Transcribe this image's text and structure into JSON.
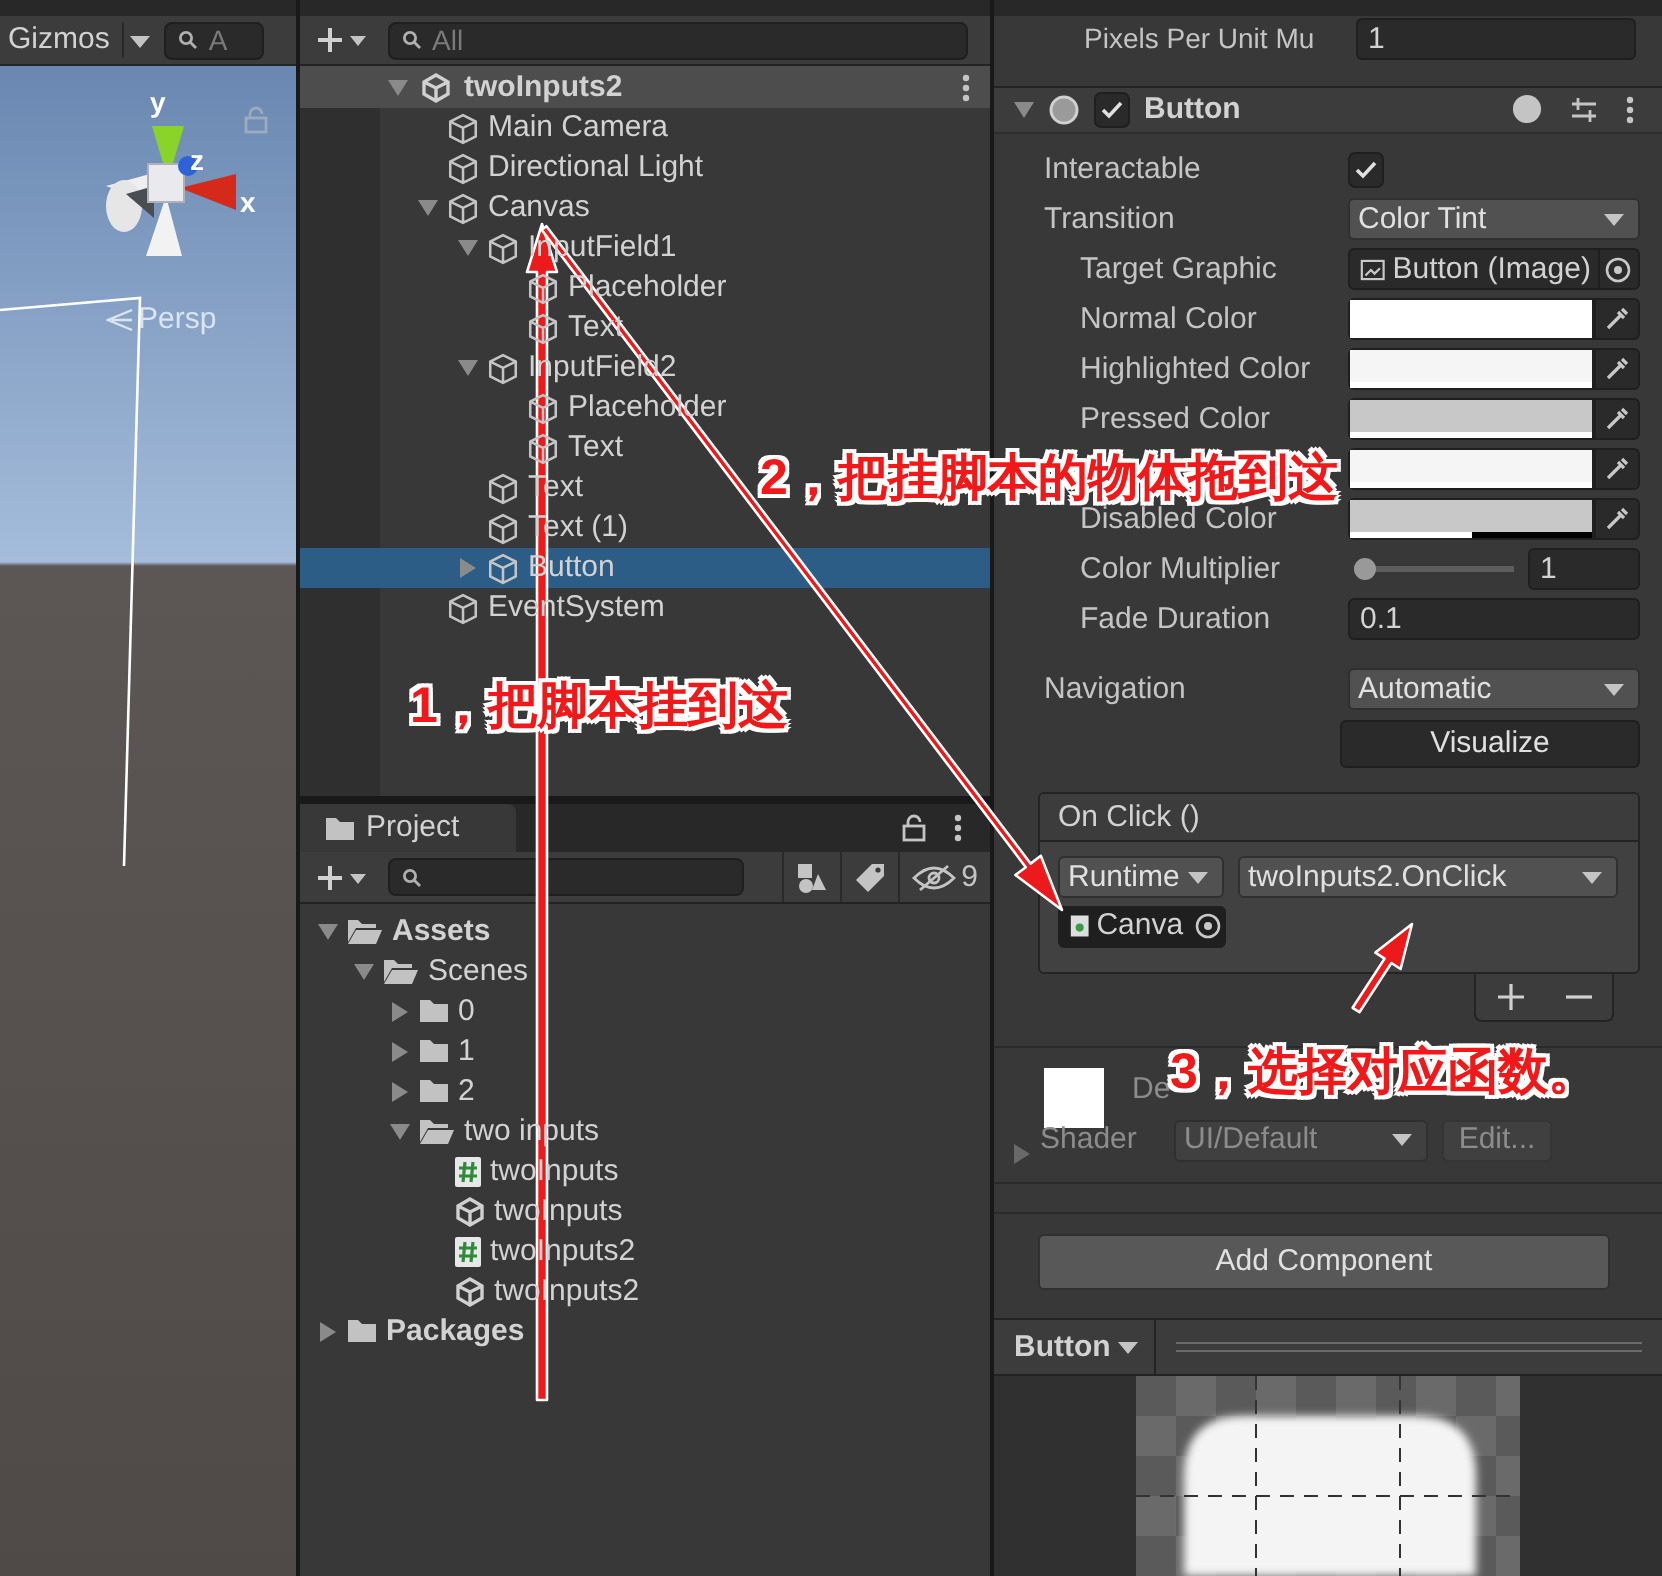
{
  "scene_view": {
    "gizmos_button": "Gizmos",
    "search_placeholder": "A",
    "axis_labels": [
      "y",
      "z",
      "x"
    ],
    "projection_label": "Persp"
  },
  "hierarchy": {
    "search_placeholder": "All",
    "scene": {
      "name": "twoInputs2",
      "expanded": true
    },
    "items": [
      {
        "name": "Main Camera",
        "selected": false
      },
      {
        "name": "Directional Light",
        "selected": false
      },
      {
        "name": "Canvas",
        "selected": false,
        "expanded": true,
        "children": [
          {
            "name": "InputField1",
            "selected": false,
            "expanded": true,
            "children": [
              {
                "name": "Placeholder",
                "selected": false
              },
              {
                "name": "Text",
                "selected": false
              }
            ]
          },
          {
            "name": "InputField2",
            "selected": false,
            "expanded": true,
            "children": [
              {
                "name": "Placeholder",
                "selected": false
              },
              {
                "name": "Text",
                "selected": false
              }
            ]
          },
          {
            "name": "Text",
            "selected": false
          },
          {
            "name": "Text (1)",
            "selected": false
          },
          {
            "name": "Button",
            "selected": true,
            "expanded": false
          }
        ]
      },
      {
        "name": "EventSystem",
        "selected": false
      }
    ]
  },
  "project": {
    "tab": "Project",
    "hidden_count": "9",
    "tree": [
      {
        "name": "Assets",
        "kind": "folder",
        "expanded": true,
        "children": [
          {
            "name": "Scenes",
            "kind": "folder",
            "expanded": true,
            "children": [
              {
                "name": "0",
                "kind": "folder",
                "expanded": false
              },
              {
                "name": "1",
                "kind": "folder",
                "expanded": false
              },
              {
                "name": "2",
                "kind": "folder",
                "expanded": false
              },
              {
                "name": "two inputs",
                "kind": "folder",
                "expanded": true,
                "children": [
                  {
                    "name": "twoInputs",
                    "kind": "script"
                  },
                  {
                    "name": "twoInputs",
                    "kind": "scene"
                  },
                  {
                    "name": "twoInputs2",
                    "kind": "script"
                  },
                  {
                    "name": "twoInputs2",
                    "kind": "scene"
                  }
                ]
              }
            ]
          }
        ]
      },
      {
        "name": "Packages",
        "kind": "folder",
        "expanded": false
      }
    ]
  },
  "inspector": {
    "pixels_per_unit": {
      "label": "Pixels Per Unit Mu",
      "value": "1"
    },
    "component": {
      "name": "Button",
      "enabled": true,
      "expanded": true
    },
    "properties": [
      {
        "kind": "checkbox",
        "label": "Interactable",
        "checked": true
      },
      {
        "kind": "dropdown",
        "label": "Transition",
        "value": "Color Tint",
        "children": [
          {
            "kind": "object",
            "label": "Target Graphic",
            "value": "Button (Image)"
          },
          {
            "kind": "color",
            "label": "Normal Color",
            "color": "#ffffff",
            "level": 1
          },
          {
            "kind": "color",
            "label": "Highlighted Color",
            "color": "#f5f5f5",
            "level": 1
          },
          {
            "kind": "color",
            "label": "Pressed Color",
            "color": "#c8c8c8",
            "level": 1
          },
          {
            "kind": "color",
            "color": "#f5f5f5",
            "level": 1
          },
          {
            "kind": "color",
            "label": "Disabled Color",
            "color": "#c8c8c8",
            "level": 0.5
          },
          {
            "kind": "slider",
            "label": "Color Multiplier",
            "level": 0,
            "value": "1"
          },
          {
            "kind": "text",
            "label": "Fade Duration",
            "value": "0.1"
          }
        ]
      },
      {
        "kind": "dropdown",
        "label": "Navigation",
        "value": "Automatic"
      }
    ],
    "visualize_button": "Visualize",
    "on_click": {
      "title": "On Click ()",
      "runtime": "Runtime",
      "function": "twoInputs2.OnClick",
      "object": "Canva"
    },
    "material": {
      "name": "De",
      "shader_label": "Shader",
      "shader": "UI/Default",
      "edit_button": "Edit...",
      "expanded": false
    },
    "add_component_button": "Add Component",
    "preview": {
      "title": "Button"
    }
  },
  "annotations": [
    {
      "text": "1，把脚本挂到这"
    },
    {
      "text": "2，把挂脚本的物体拖到这"
    },
    {
      "text": "3，选择对应函数。"
    }
  ]
}
